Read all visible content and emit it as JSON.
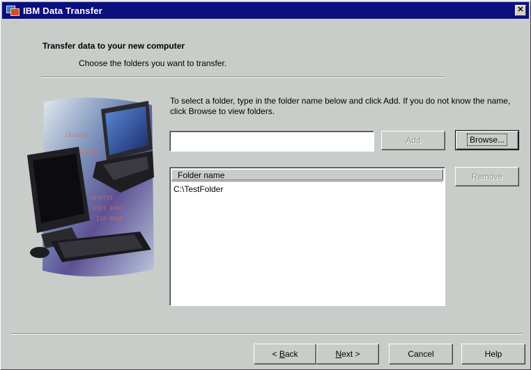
{
  "window": {
    "title": "IBM Data Transfer",
    "close_glyph": "✕",
    "icon": "ibm-data-transfer-app-icon"
  },
  "header": {
    "title": "Transfer data to your new computer",
    "subtitle": "Choose the folders you want to transfer."
  },
  "instructions": "To select a folder, type in the folder name below and click Add.  If you do not know the name, click Browse to view folders.",
  "folder_input": {
    "value": "",
    "placeholder": ""
  },
  "buttons": {
    "add": "Add",
    "browse": "Browse...",
    "remove": "Remove",
    "back_accel": "B",
    "back_rest": "ack",
    "back_prefix": "< ",
    "next_accel": "N",
    "next_rest": "ext >",
    "cancel": "Cancel",
    "help": "Help"
  },
  "folder_list": {
    "columns": [
      "Folder name"
    ],
    "rows": [
      "C:\\TestFolder"
    ]
  },
  "colors": {
    "titlebar": "#0b0f7d",
    "dialog_bg": "#c9cdc9",
    "disabled_text": "#8e928e"
  }
}
